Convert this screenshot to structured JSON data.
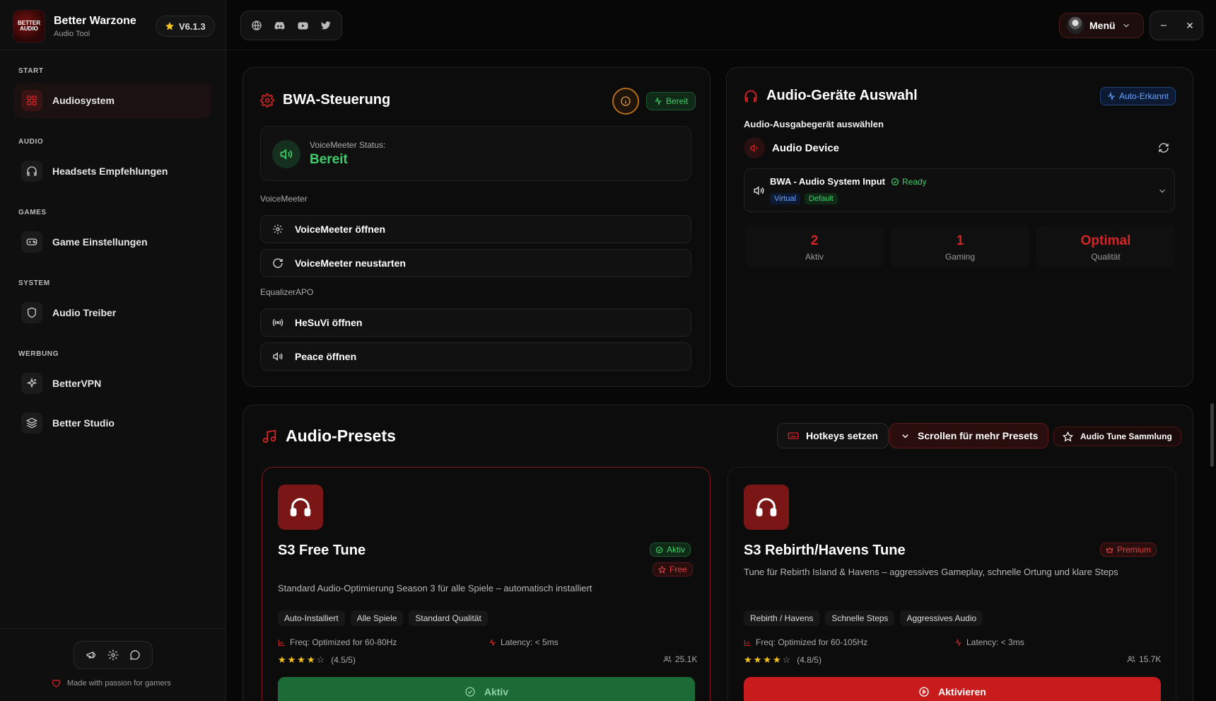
{
  "app": {
    "name": "Better Warzone",
    "subtitle": "Audio Tool",
    "version": "V6.1.3",
    "logo_text": "BETTER AUDIO"
  },
  "colors": {
    "accent": "#d42424",
    "success": "#3ecf6a",
    "background": "#070707",
    "info": "#4a8cff"
  },
  "sidebar": {
    "sections": [
      {
        "title": "START",
        "items": [
          {
            "label": "Audiosystem",
            "icon": "grid-icon",
            "active": true
          }
        ]
      },
      {
        "title": "AUDIO",
        "items": [
          {
            "label": "Headsets Empfehlungen",
            "icon": "headphones-icon"
          }
        ]
      },
      {
        "title": "GAMES",
        "items": [
          {
            "label": "Game Einstellungen",
            "icon": "gamepad-icon"
          }
        ]
      },
      {
        "title": "SYSTEM",
        "items": [
          {
            "label": "Audio Treiber",
            "icon": "shield-icon"
          }
        ]
      },
      {
        "title": "WERBUNG",
        "items": [
          {
            "label": "BetterVPN",
            "icon": "sparkles-icon"
          },
          {
            "label": "Better Studio",
            "icon": "layers-icon"
          }
        ]
      }
    ],
    "footer": "Made with passion for gamers"
  },
  "topbar": {
    "menu_label": "Menü",
    "socials": [
      "globe-icon",
      "discord-icon",
      "youtube-icon",
      "twitter-icon"
    ]
  },
  "bwa": {
    "title": "BWA-Steuerung",
    "status_badge": "Bereit",
    "vm_status_label": "VoiceMeeter Status:",
    "vm_status_value": "Bereit",
    "group_voicemeeter": "VoiceMeeter",
    "btn_open_vm": "VoiceMeeter öffnen",
    "btn_restart_vm": "VoiceMeeter neustarten",
    "group_eq": "EqualizerAPO",
    "btn_hesuvi": "HeSuVi öffnen",
    "btn_peace": "Peace öffnen"
  },
  "devices": {
    "title": "Audio-Geräte Auswahl",
    "auto_badge": "Auto-Erkannt",
    "subtitle": "Audio-Ausgabegerät auswählen",
    "device_header": "Audio Device",
    "selected": {
      "name": "BWA - Audio System Input",
      "status": "Ready",
      "tags": [
        "Virtual",
        "Default"
      ]
    },
    "stats": [
      {
        "value": "2",
        "label": "Aktiv"
      },
      {
        "value": "1",
        "label": "Gaming"
      },
      {
        "value": "Optimal",
        "label": "Qualität"
      }
    ]
  },
  "presets": {
    "title": "Audio-Presets",
    "btn_hotkeys": "Hotkeys setzen",
    "btn_scroll": "Scrollen für mehr Presets",
    "btn_collection": "Audio Tune Sammlung",
    "cards": [
      {
        "title": "S3 Free Tune",
        "badge_active": "Aktiv",
        "badge_type": "Free",
        "description": "Standard Audio-Optimierung Season 3 für alle Spiele – automatisch installiert",
        "tags": [
          "Auto-Installiert",
          "Alle Spiele",
          "Standard Qualität"
        ],
        "freq": "Freq: Optimized for 60-80Hz",
        "latency": "Latency: < 5ms",
        "rating": 4.5,
        "rating_text": "(4.5/5)",
        "users": "25.1K",
        "button": "Aktiv"
      },
      {
        "title": "S3 Rebirth/Havens Tune",
        "badge_type": "Premium",
        "description": "Tune für Rebirth Island & Havens – aggressives Gameplay, schnelle Ortung und klare Steps",
        "tags": [
          "Rebirth / Havens",
          "Schnelle Steps",
          "Aggressives Audio"
        ],
        "freq": "Freq: Optimized for 60-105Hz",
        "latency": "Latency: < 3ms",
        "rating": 4.8,
        "rating_text": "(4.8/5)",
        "users": "15.7K",
        "button": "Aktivieren"
      }
    ]
  }
}
